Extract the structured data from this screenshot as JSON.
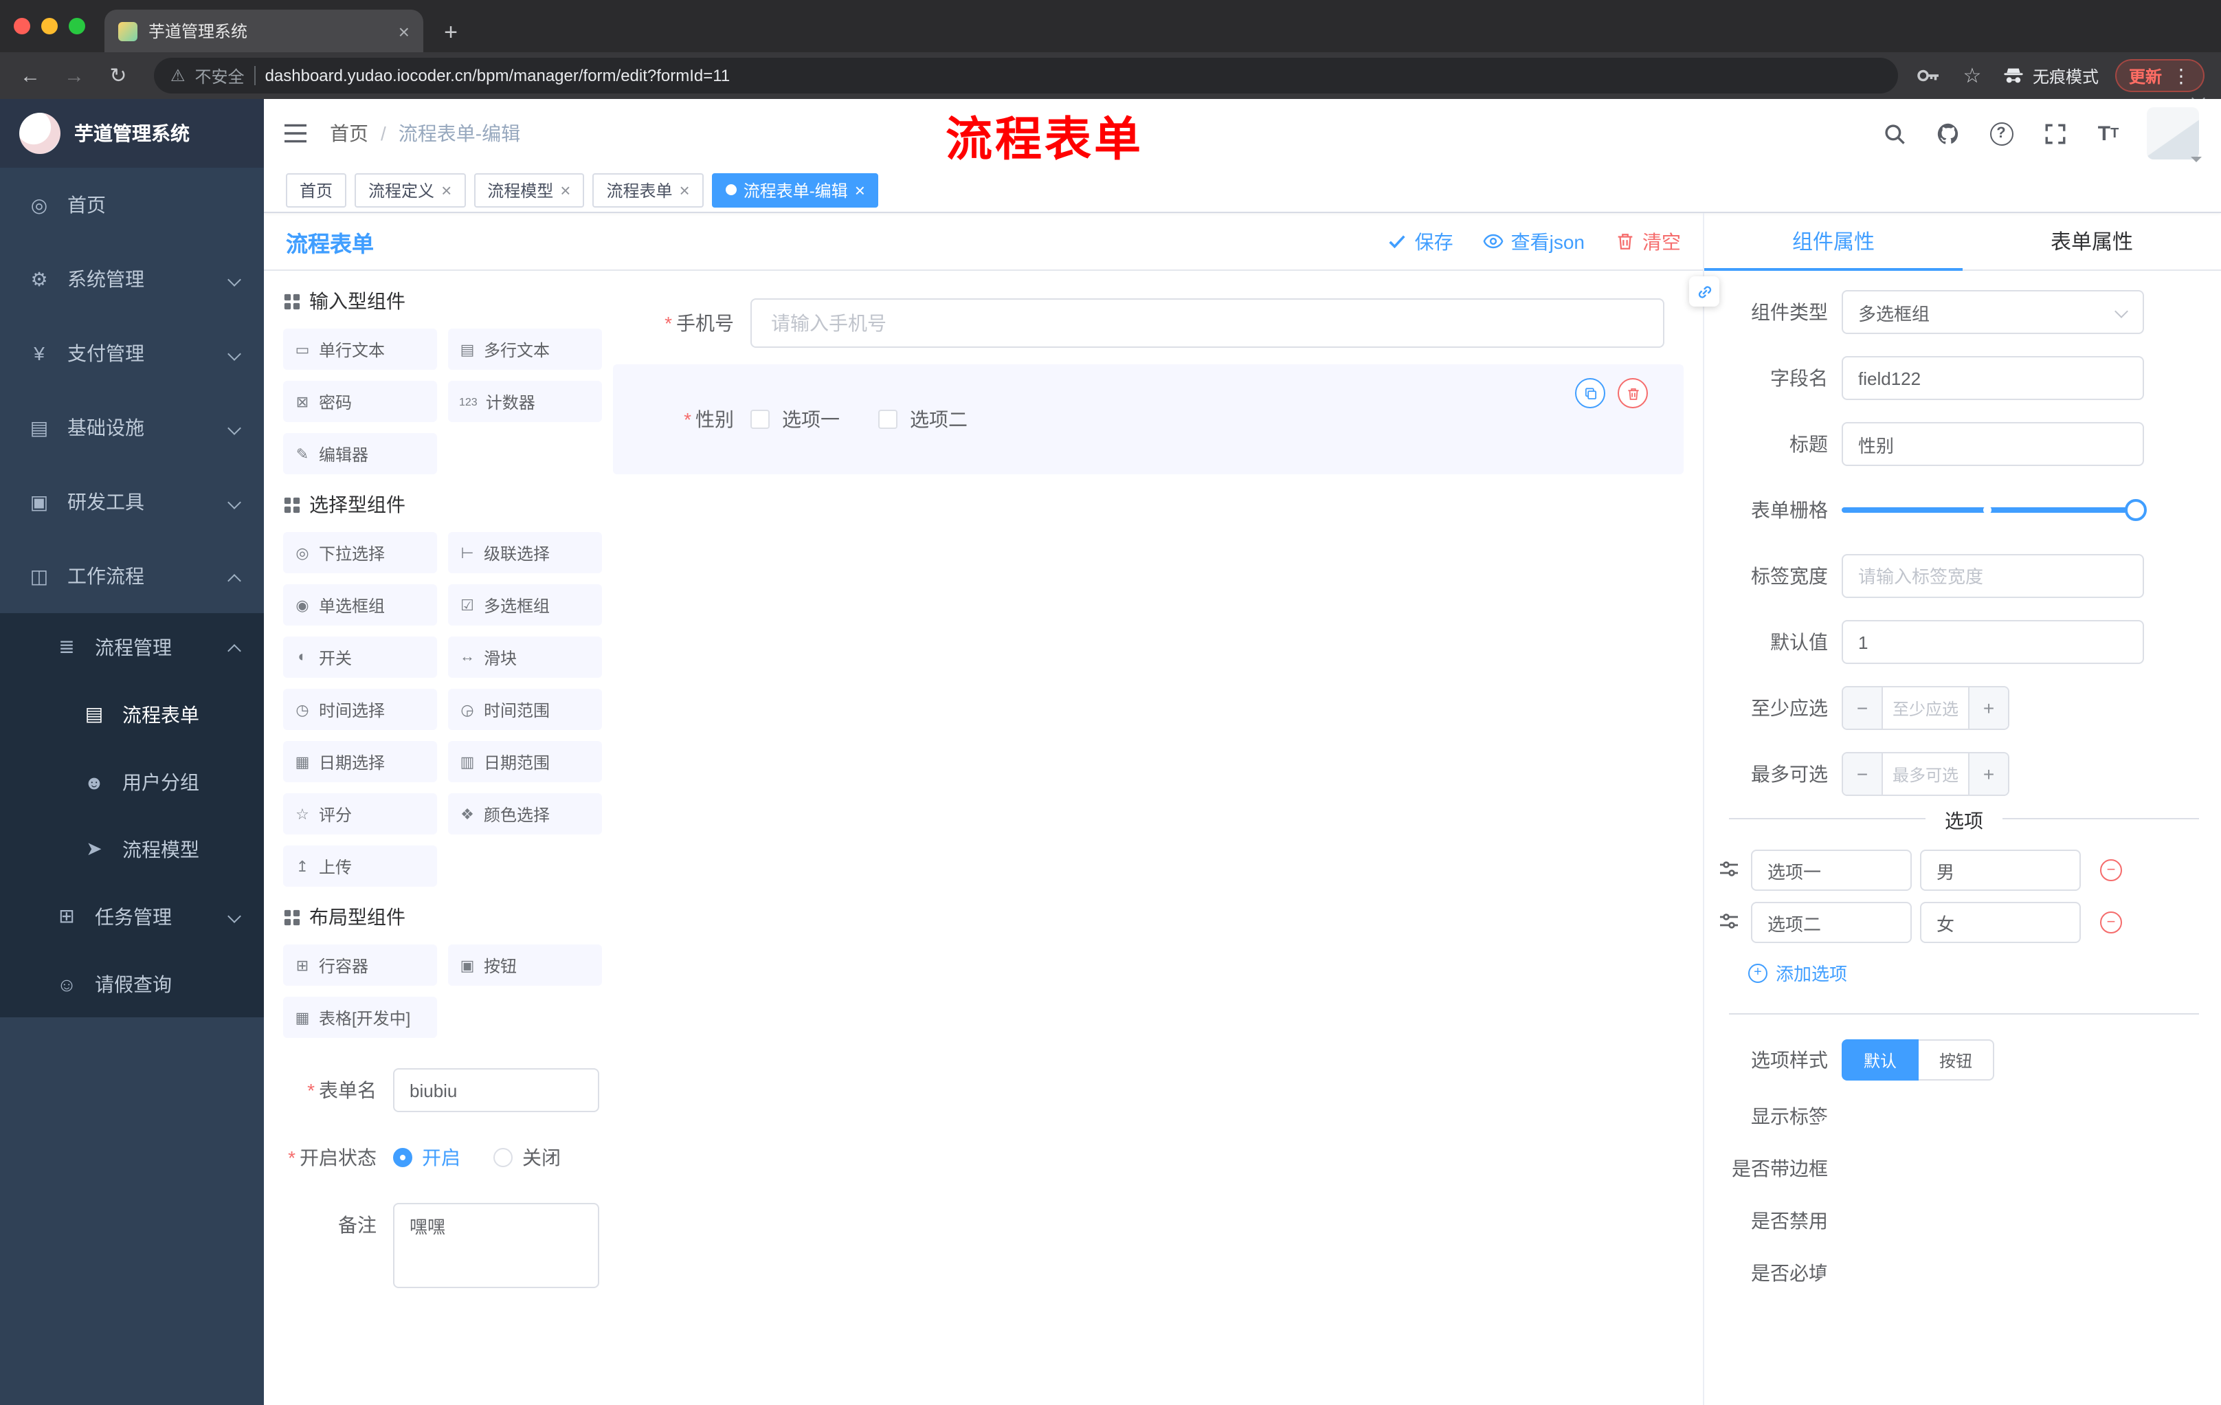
{
  "colors": {
    "primary": "#409eff",
    "danger": "#f56c6c",
    "annotation": "#ff0000",
    "sidebar_bg": "#304156",
    "sidebar_sub_bg": "#1f2d3d"
  },
  "browser": {
    "tab_title": "芋道管理系统",
    "security": "不安全",
    "url": "dashboard.yudao.iocoder.cn/bpm/manager/form/edit?formId=11",
    "incognito": "无痕模式",
    "update": "更新"
  },
  "header": {
    "breadcrumb": [
      "首页",
      "流程表单-编辑"
    ],
    "annotation": "流程表单"
  },
  "sidebar": {
    "title": "芋道管理系统",
    "top": [
      {
        "label": "首页",
        "glyph": "◎"
      },
      {
        "label": "系统管理",
        "glyph": "⚙"
      },
      {
        "label": "支付管理",
        "glyph": "¥"
      },
      {
        "label": "基础设施",
        "glyph": "▤"
      },
      {
        "label": "研发工具",
        "glyph": "▣"
      },
      {
        "label": "工作流程",
        "glyph": "◫"
      }
    ],
    "sub": {
      "process_mgmt": {
        "label": "流程管理",
        "glyph": "≣"
      },
      "children": [
        {
          "label": "流程表单",
          "glyph": "▤"
        },
        {
          "label": "用户分组",
          "glyph": "☻"
        },
        {
          "label": "流程模型",
          "glyph": "➤"
        }
      ],
      "task_mgmt": {
        "label": "任务管理",
        "glyph": "⊞"
      },
      "leave_query": {
        "label": "请假查询",
        "glyph": "☺"
      }
    }
  },
  "tags": [
    {
      "label": "首页"
    },
    {
      "label": "流程定义"
    },
    {
      "label": "流程模型"
    },
    {
      "label": "流程表单"
    },
    {
      "label": "流程表单-编辑"
    }
  ],
  "designer": {
    "title": "流程表单",
    "save": "保存",
    "view_json": "查看json",
    "clear": "清空"
  },
  "palette": {
    "groups": [
      {
        "title": "输入型组件",
        "items": [
          {
            "label": "单行文本",
            "glyph": "▭"
          },
          {
            "label": "多行文本",
            "glyph": "▤"
          },
          {
            "label": "密码",
            "glyph": "⊠"
          },
          {
            "label": "计数器",
            "glyph": "123"
          },
          {
            "label": "编辑器",
            "glyph": "✎"
          }
        ]
      },
      {
        "title": "选择型组件",
        "items": [
          {
            "label": "下拉选择",
            "glyph": "◎"
          },
          {
            "label": "级联选择",
            "glyph": "⊢"
          },
          {
            "label": "单选框组",
            "glyph": "◉"
          },
          {
            "label": "多选框组",
            "glyph": "☑"
          },
          {
            "label": "开关",
            "glyph": "◐"
          },
          {
            "label": "滑块",
            "glyph": "↔"
          },
          {
            "label": "时间选择",
            "glyph": "◷"
          },
          {
            "label": "时间范围",
            "glyph": "◶"
          },
          {
            "label": "日期选择",
            "glyph": "▦"
          },
          {
            "label": "日期范围",
            "glyph": "▥"
          },
          {
            "label": "评分",
            "glyph": "☆"
          },
          {
            "label": "颜色选择",
            "glyph": "❖"
          },
          {
            "label": "上传",
            "glyph": "↥"
          }
        ]
      },
      {
        "title": "布局型组件",
        "items": [
          {
            "label": "行容器",
            "glyph": "⊞"
          },
          {
            "label": "按钮",
            "glyph": "▣"
          },
          {
            "label": "表格[开发中]",
            "glyph": "▦"
          }
        ]
      }
    ],
    "form": {
      "name_label": "表单名",
      "name_value": "biubiu",
      "status_label": "开启状态",
      "status_on": "开启",
      "status_off": "关闭",
      "remark_label": "备注",
      "remark_value": "嘿嘿"
    }
  },
  "canvas": {
    "phone": {
      "label": "手机号",
      "placeholder": "请输入手机号"
    },
    "gender": {
      "label": "性别",
      "option1": "选项一",
      "option2": "选项二"
    }
  },
  "props": {
    "tab_component": "组件属性",
    "tab_form": "表单属性",
    "component_type_label": "组件类型",
    "component_type_value": "多选框组",
    "field_label": "字段名",
    "field_value": "field122",
    "title_label": "标题",
    "title_value": "性别",
    "grid_label": "表单栅格",
    "label_width_label": "标签宽度",
    "label_width_placeholder": "请输入标签宽度",
    "default_label": "默认值",
    "default_value": "1",
    "min_label": "至少应选",
    "min_placeholder": "至少应选",
    "max_label": "最多可选",
    "max_placeholder": "最多可选",
    "options_title": "选项",
    "options": [
      {
        "name": "选项一",
        "value": "男"
      },
      {
        "name": "选项二",
        "value": "女"
      }
    ],
    "add_option": "添加选项",
    "style_label": "选项样式",
    "style_default": "默认",
    "style_button": "按钮",
    "switch_show_label": "显示标签",
    "switch_border": "是否带边框",
    "switch_disabled": "是否禁用",
    "switch_required": "是否必填"
  }
}
